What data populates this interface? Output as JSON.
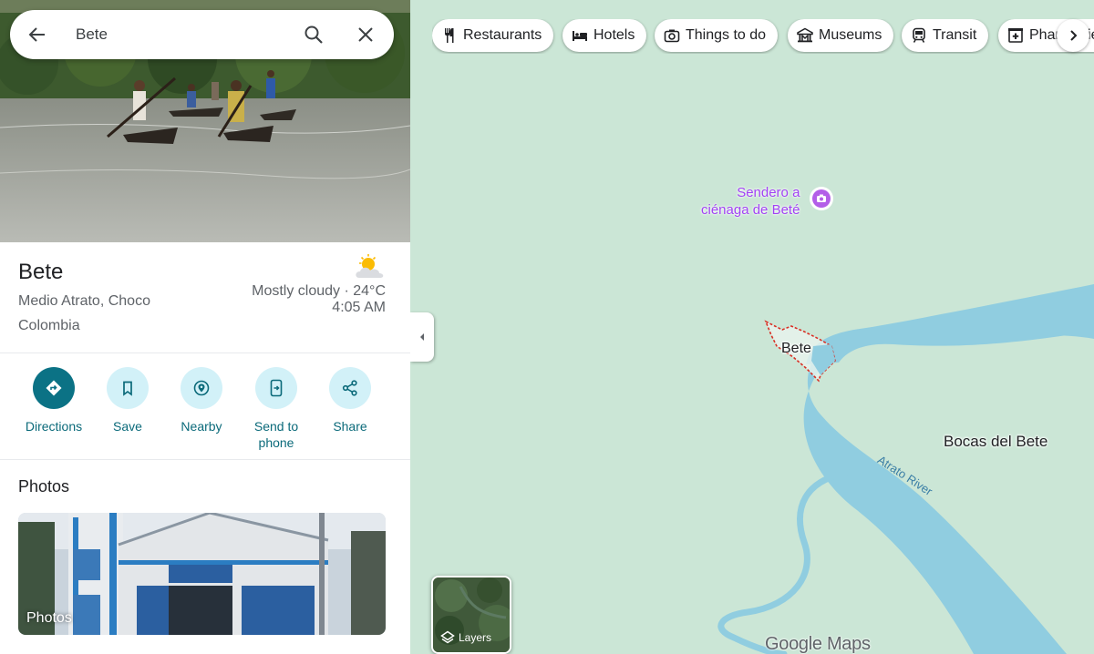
{
  "search": {
    "query": "Bete"
  },
  "place": {
    "name": "Bete",
    "address_line1": "Medio Atrato, Choco",
    "address_line2": "Colombia",
    "weather": {
      "condition": "Mostly cloudy · 24°C",
      "time": "4:05 AM",
      "icon": "partly-cloudy-icon"
    }
  },
  "actions": [
    {
      "label": "Directions",
      "icon": "directions-icon"
    },
    {
      "label": "Save",
      "icon": "bookmark-icon"
    },
    {
      "label": "Nearby",
      "icon": "nearby-icon"
    },
    {
      "label": "Send to phone",
      "icon": "send-to-phone-icon"
    },
    {
      "label": "Share",
      "icon": "share-icon"
    }
  ],
  "photos": {
    "heading": "Photos",
    "card_label": "Photos"
  },
  "chips": [
    {
      "label": "Restaurants",
      "icon": "utensils-icon"
    },
    {
      "label": "Hotels",
      "icon": "bed-icon"
    },
    {
      "label": "Things to do",
      "icon": "camera-icon"
    },
    {
      "label": "Museums",
      "icon": "museum-icon"
    },
    {
      "label": "Transit",
      "icon": "train-icon"
    },
    {
      "label": "Pharmacies",
      "icon": "pharmacy-icon"
    }
  ],
  "map": {
    "poi_line1": "Sendero a",
    "poi_line2": "ciénaga de Beté",
    "town_label": "Bete",
    "area_label": "Bocas del Bete",
    "river_label": "Atrato River",
    "layers_label": "Layers",
    "logo": "Google Maps"
  },
  "colors": {
    "accent": "#0b7285",
    "accent_light": "#d2f1f8",
    "water": "#90cde0",
    "land": "#cbe6d6",
    "poi": "#a142f4"
  }
}
